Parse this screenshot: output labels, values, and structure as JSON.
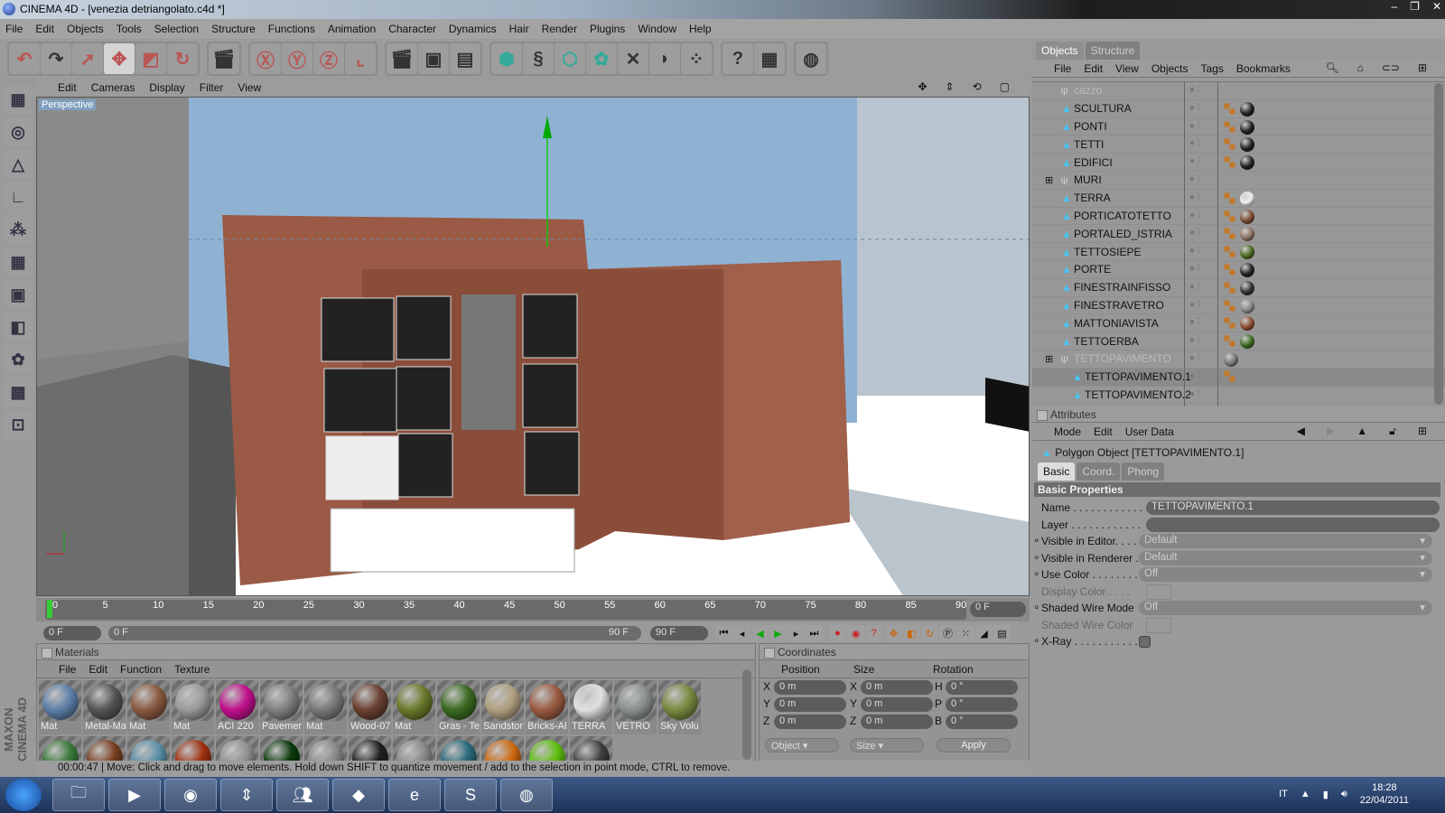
{
  "window": {
    "title": "CINEMA 4D - [venezia detriangolato.c4d *]"
  },
  "menu": [
    "File",
    "Edit",
    "Objects",
    "Tools",
    "Selection",
    "Structure",
    "Functions",
    "Animation",
    "Character",
    "Dynamics",
    "Hair",
    "Render",
    "Plugins",
    "Window",
    "Help"
  ],
  "toolbar": {
    "groups": [
      [
        "undo-icon",
        "redo-icon",
        "live-selection-icon",
        "move-icon",
        "scale-icon",
        "rotate-icon"
      ],
      [
        "coordinate-system-icon"
      ],
      [
        "x-axis-lock-icon",
        "y-axis-lock-icon",
        "z-axis-lock-icon",
        "world-axis-icon"
      ],
      [
        "render-view-icon",
        "render-picture-viewer-icon",
        "render-settings-icon"
      ],
      [
        "cube-icon",
        "spline-icon",
        "nurbs-icon",
        "modeling-icon",
        "deformer-icon",
        "scene-icon",
        "particle-icon"
      ],
      [
        "help-cursor-icon",
        "layout-help-icon"
      ],
      [
        "globe-icon"
      ]
    ],
    "axes": [
      "X",
      "Y",
      "Z"
    ]
  },
  "left_tools": [
    "use-model-mode",
    "use-object-mode",
    "use-points-mode",
    "use-edges-mode",
    "use-polygons-mode",
    "axis-mode",
    "texture-mode",
    "workplane-mode",
    "tweak-mode",
    "snap-mode",
    "soft-selection-mode"
  ],
  "viewport": {
    "menu": [
      "Edit",
      "Cameras",
      "Display",
      "Filter",
      "View"
    ],
    "label": "Perspective"
  },
  "timeline": {
    "ticks": [
      "0",
      "5",
      "10",
      "15",
      "20",
      "25",
      "30",
      "35",
      "40",
      "45",
      "50",
      "55",
      "60",
      "65",
      "70",
      "75",
      "80",
      "85",
      "90"
    ],
    "current_frame": "0 F",
    "start": "0 F",
    "range_start": "0 F",
    "range_end": "90 F",
    "end": "90 F"
  },
  "materials": {
    "title": "Materials",
    "menu": [
      "File",
      "Edit",
      "Function",
      "Texture"
    ],
    "items": [
      {
        "name": "Mat",
        "color": "#5d7fa8"
      },
      {
        "name": "Metal-Ma",
        "color": "#555555"
      },
      {
        "name": "Mat",
        "color": "#8a5a40"
      },
      {
        "name": "Mat",
        "color": "#9a9a9a"
      },
      {
        "name": "ACI 220",
        "color": "#c0108c"
      },
      {
        "name": "Pavemer",
        "color": "#808080"
      },
      {
        "name": "Mat",
        "color": "#7a7a7a"
      },
      {
        "name": "Wood-07",
        "color": "#6a4030"
      },
      {
        "name": "Mat",
        "color": "#6a7a2a"
      },
      {
        "name": "Gras - Te",
        "color": "#3a6a20"
      },
      {
        "name": "Sandstor",
        "color": "#b0a080"
      },
      {
        "name": "Bricks-Al",
        "color": "#9a5a40"
      },
      {
        "name": "TERRA",
        "color": "#e0e0e0"
      },
      {
        "name": "VETRO",
        "color": "#8a9090"
      },
      {
        "name": "Sky Volu",
        "color": "#7a8a40"
      },
      {
        "name": "",
        "color": "#3a7a3a"
      },
      {
        "name": "",
        "color": "#7a4020"
      },
      {
        "name": "",
        "color": "#5a90a8"
      },
      {
        "name": "",
        "color": "#a03010"
      },
      {
        "name": "",
        "color": "#909090"
      },
      {
        "name": "",
        "color": "#0a3a0a"
      },
      {
        "name": "",
        "color": "#8a8a8a"
      },
      {
        "name": "",
        "color": "#202020"
      },
      {
        "name": "",
        "color": "#8a8a8a"
      },
      {
        "name": "",
        "color": "#2a6a7a"
      },
      {
        "name": "",
        "color": "#d06a10"
      },
      {
        "name": "",
        "color": "#60c010"
      },
      {
        "name": "",
        "color": "#404040"
      }
    ]
  },
  "coordinates": {
    "title": "Coordinates",
    "headers": [
      "Position",
      "Size",
      "Rotation"
    ],
    "rows": [
      {
        "pl": "X",
        "p": "0 m",
        "sl": "X",
        "s": "0 m",
        "rl": "H",
        "r": "0 °"
      },
      {
        "pl": "Y",
        "p": "0 m",
        "sl": "Y",
        "s": "0 m",
        "rl": "P",
        "r": "0 °"
      },
      {
        "pl": "Z",
        "p": "0 m",
        "sl": "Z",
        "s": "0 m",
        "rl": "B",
        "r": "0 °"
      }
    ],
    "mode": "Object",
    "size_mode": "Size",
    "apply": "Apply"
  },
  "status": {
    "time": "00:00:47",
    "message": "Move: Click and drag to move elements. Hold down SHIFT to quantize movement / add to the selection in point mode, CTRL to remove."
  },
  "brand": "MAXON CINEMA 4D",
  "objects": {
    "tabs": [
      "Objects",
      "Structure"
    ],
    "menu": [
      "File",
      "Edit",
      "View",
      "Objects",
      "Tags",
      "Bookmarks"
    ],
    "items": [
      {
        "name": "cazzo",
        "type": "null",
        "dim": true,
        "tags": []
      },
      {
        "name": "SCULTURA",
        "type": "poly",
        "tags": [
          "#222"
        ]
      },
      {
        "name": "PONTI",
        "type": "poly",
        "tags": [
          "#222"
        ]
      },
      {
        "name": "TETTI",
        "type": "poly",
        "tags": [
          "#222"
        ]
      },
      {
        "name": "EDIFICI",
        "type": "poly",
        "tags": [
          "#222"
        ]
      },
      {
        "name": "MURI",
        "type": "null",
        "tags": []
      },
      {
        "name": "TERRA",
        "type": "poly",
        "tags": [
          "#eee"
        ]
      },
      {
        "name": "PORTICATOTETTO",
        "type": "poly",
        "tags": [
          "#7a4a30"
        ]
      },
      {
        "name": "PORTALED_ISTRIA",
        "type": "poly",
        "tags": [
          "#8a7060"
        ]
      },
      {
        "name": "TETTOSIEPE",
        "type": "poly",
        "tags": [
          "#4a6a20"
        ]
      },
      {
        "name": "PORTE",
        "type": "poly",
        "tags": [
          "#222"
        ]
      },
      {
        "name": "FINESTRAINFISSO",
        "type": "poly",
        "tags": [
          "#333"
        ]
      },
      {
        "name": "FINESTRAVETRO",
        "type": "poly",
        "tags": [
          "#888"
        ]
      },
      {
        "name": "MATTONIAVISTA",
        "type": "poly",
        "tags": [
          "#8a4a30"
        ]
      },
      {
        "name": "TETTOERBA",
        "type": "poly",
        "tags": [
          "#3a6a20"
        ]
      },
      {
        "name": "TETTOPAVIMENTO",
        "type": "null",
        "dim": true,
        "tags": [
          "#777"
        ]
      },
      {
        "name": "TETTOPAVIMENTO.1",
        "type": "poly",
        "selected": true,
        "tags": []
      },
      {
        "name": "TETTOPAVIMENTO.2",
        "type": "poly",
        "tags": []
      }
    ]
  },
  "attributes": {
    "title": "Attributes",
    "menu": [
      "Mode",
      "Edit",
      "User Data"
    ],
    "object": "Polygon Object [TETTOPAVIMENTO.1]",
    "tabs": [
      "Basic",
      "Coord.",
      "Phong"
    ],
    "section": "Basic Properties",
    "props": [
      {
        "label": "Name . . . . . . . . . . . .",
        "value": "TETTOPAVIMENTO.1"
      },
      {
        "label": "Layer . . . . . . . . . . . .",
        "value": ""
      },
      {
        "label": "Visible in Editor. . . . .",
        "value": "Default"
      },
      {
        "label": "Visible in Renderer . .",
        "value": "Default"
      },
      {
        "label": "Use Color . . . . . . . . .",
        "value": "Off"
      },
      {
        "label": "Display Color . . . .",
        "value": ""
      },
      {
        "label": "Shaded Wire Mode",
        "value": "Off"
      },
      {
        "label": "Shaded Wire Color",
        "value": ""
      },
      {
        "label": "X-Ray . . . . . . . . . . . .",
        "value": ""
      }
    ]
  },
  "taskbar": {
    "apps": [
      "windows-explorer",
      "media-player",
      "chrome",
      "updater",
      "messenger",
      "cinema4d",
      "internet-explorer",
      "skype",
      "globe-app"
    ],
    "language": "IT",
    "time": "18:28",
    "date": "22/04/2011"
  }
}
